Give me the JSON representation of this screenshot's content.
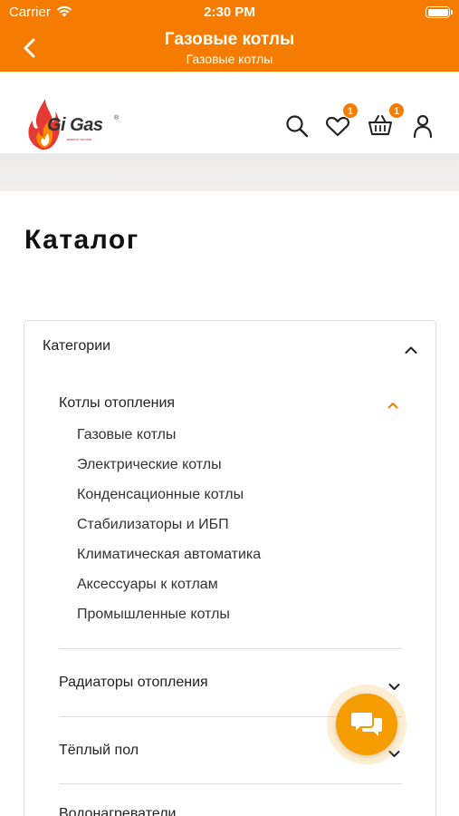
{
  "status_bar": {
    "carrier": "Carrier",
    "time": "2:30 PM"
  },
  "nav": {
    "title": "Газовые котлы",
    "subtitle": "Газовые котлы",
    "back_icon": "chevron-left-icon",
    "background": "#f57c00"
  },
  "header": {
    "logo_text": "Gi Gas",
    "logo_trademark": "®",
    "logo_tagline": "вместе теплее",
    "favorites_count": "1",
    "cart_count": "1",
    "icons": [
      "search-icon",
      "heart-icon",
      "basket-icon",
      "user-icon"
    ]
  },
  "page": {
    "title": "Каталог"
  },
  "catalog": {
    "heading": "Категории",
    "groups": [
      {
        "label": "Котлы отопления",
        "expanded": true,
        "items": [
          "Газовые котлы",
          "Электрические котлы",
          "Конденсационные котлы",
          "Стабилизаторы и ИБП",
          "Климатическая автоматика",
          "Аксессуары к котлам",
          "Промышленные котлы"
        ]
      },
      {
        "label": "Радиаторы отопления",
        "expanded": false
      },
      {
        "label": "Тёплый пол",
        "expanded": false
      },
      {
        "label": "Водонагреватели",
        "expanded": false
      }
    ]
  },
  "chat_button": {
    "icon": "chat-bubbles-icon",
    "color": "#f59d00"
  },
  "colors": {
    "accent": "#f57c00"
  }
}
